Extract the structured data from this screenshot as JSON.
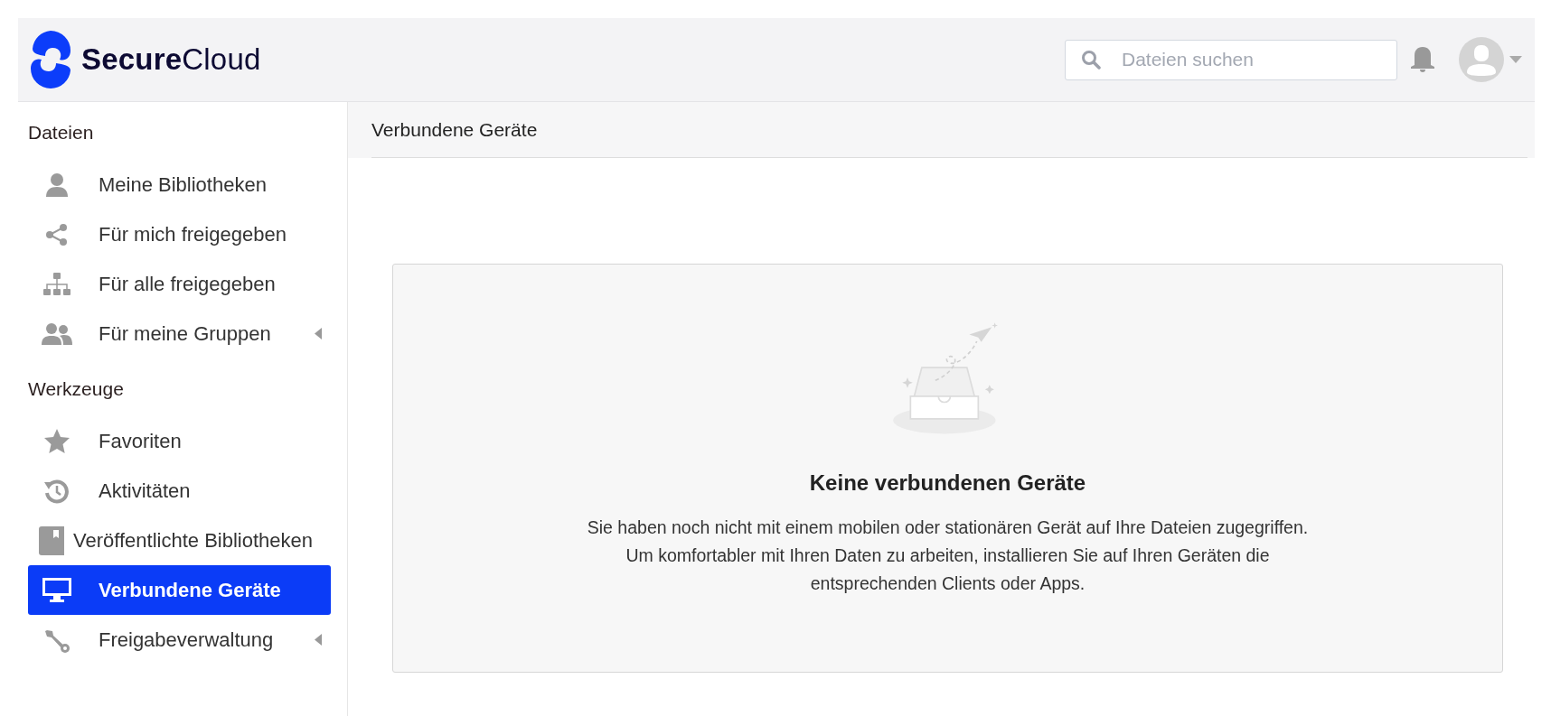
{
  "header": {
    "logo": {
      "bold_part": "Secure",
      "regular_part": "Cloud"
    },
    "search": {
      "placeholder": "Dateien suchen"
    }
  },
  "sidebar": {
    "sections": [
      {
        "title": "Dateien",
        "items": [
          {
            "label": "Meine Bibliotheken",
            "selected": false,
            "expandable": false
          },
          {
            "label": "Für mich freigegeben",
            "selected": false,
            "expandable": false
          },
          {
            "label": "Für alle freigegeben",
            "selected": false,
            "expandable": false
          },
          {
            "label": "Für meine Gruppen",
            "selected": false,
            "expandable": true
          }
        ]
      },
      {
        "title": "Werkzeuge",
        "items": [
          {
            "label": "Favoriten",
            "selected": false,
            "expandable": false
          },
          {
            "label": "Aktivitäten",
            "selected": false,
            "expandable": false
          },
          {
            "label": "Veröffentlichte Bibliotheken",
            "selected": false,
            "expandable": false
          },
          {
            "label": "Verbundene Geräte",
            "selected": true,
            "expandable": false
          },
          {
            "label": "Freigabeverwaltung",
            "selected": false,
            "expandable": true
          }
        ]
      }
    ]
  },
  "main": {
    "title": "Verbundene Geräte",
    "empty_state": {
      "heading": "Keine verbundenen Geräte",
      "paragraphs": [
        "Sie haben noch nicht mit einem mobilen oder stationären Gerät auf Ihre Dateien zugegriffen.",
        "Um komfortabler mit Ihren Daten zu arbeiten, installieren Sie auf Ihren Geräten die entsprechenden Clients oder Apps."
      ]
    }
  }
}
